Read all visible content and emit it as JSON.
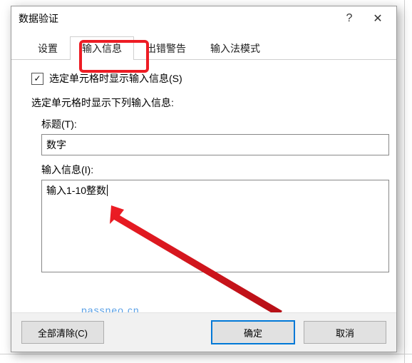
{
  "dialog": {
    "title": "数据验证",
    "help_symbol": "?",
    "close_symbol": "✕"
  },
  "tabs": [
    {
      "label": "设置"
    },
    {
      "label": "输入信息",
      "active": true
    },
    {
      "label": "出错警告"
    },
    {
      "label": "输入法模式"
    }
  ],
  "checkbox": {
    "checked_mark": "✓",
    "label": "选定单元格时显示输入信息(S)"
  },
  "section_heading": "选定单元格时显示下列输入信息:",
  "fields": {
    "title_label": "标题(T):",
    "title_value": "数字",
    "message_label": "输入信息(I):",
    "message_value": "输入1-10整数"
  },
  "buttons": {
    "clear_all": "全部清除(C)",
    "ok": "确定",
    "cancel": "取消"
  },
  "watermark": "passneo.cn"
}
